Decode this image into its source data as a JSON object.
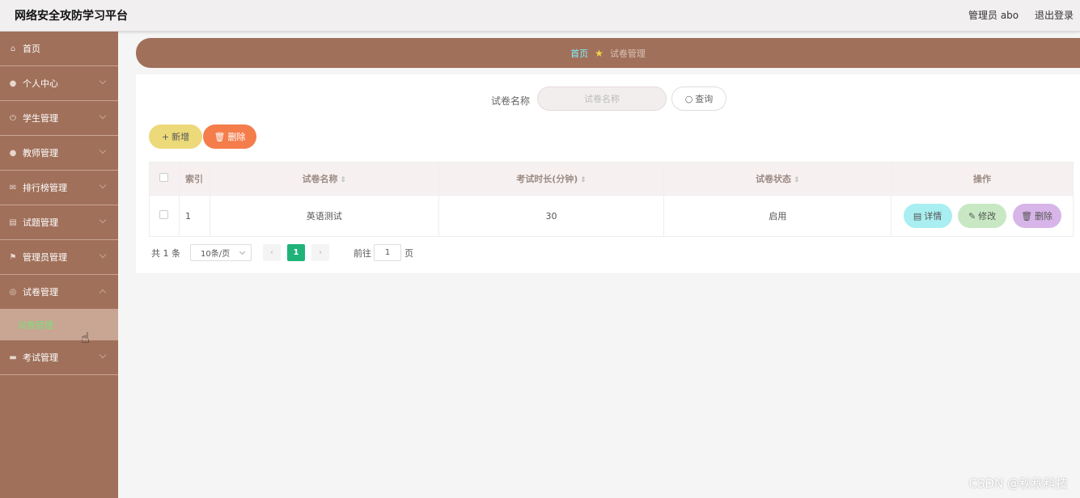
{
  "header": {
    "app_title": "网络安全攻防学习平台",
    "user_label": "管理员 abo",
    "logout_label": "退出登录"
  },
  "sidebar": {
    "items": [
      {
        "label": "首页",
        "icon": "home-icon"
      },
      {
        "label": "个人中心",
        "icon": "user-icon"
      },
      {
        "label": "学生管理",
        "icon": "power-icon"
      },
      {
        "label": "教师管理",
        "icon": "user-icon"
      },
      {
        "label": "排行榜管理",
        "icon": "mail-icon"
      },
      {
        "label": "试题管理",
        "icon": "clipboard-icon"
      },
      {
        "label": "管理员管理",
        "icon": "flag-icon"
      },
      {
        "label": "试卷管理",
        "icon": "target-icon"
      },
      {
        "label": "考试管理",
        "icon": "briefcase-icon"
      }
    ],
    "active_sub_item": "试卷管理"
  },
  "breadcrumb": {
    "home": "首页",
    "current": "试卷管理"
  },
  "search": {
    "label": "试卷名称",
    "placeholder": "试卷名称",
    "button": "查询"
  },
  "actions": {
    "add": "新增",
    "delete": "删除"
  },
  "table": {
    "headers": [
      "索引",
      "试卷名称",
      "考试时长(分钟)",
      "试卷状态",
      "操作"
    ],
    "rows": [
      {
        "index": "1",
        "name": "英语测试",
        "duration": "30",
        "status": "启用"
      }
    ],
    "row_actions": {
      "detail": "详情",
      "edit": "修改",
      "delete": "删除"
    }
  },
  "pagination": {
    "total": "共 1 条",
    "page_size": "10条/页",
    "current_page": "1",
    "goto_label": "前往",
    "goto_value": "1",
    "page_suffix": "页"
  },
  "watermark": "CSDN @秋秋科技",
  "colors": {
    "sidebar": "#a0705a",
    "breadcrumb": "#a0705a",
    "add_button": "#ecd97a",
    "delete_button": "#f47d4b",
    "pager_active": "#1fb37a"
  }
}
